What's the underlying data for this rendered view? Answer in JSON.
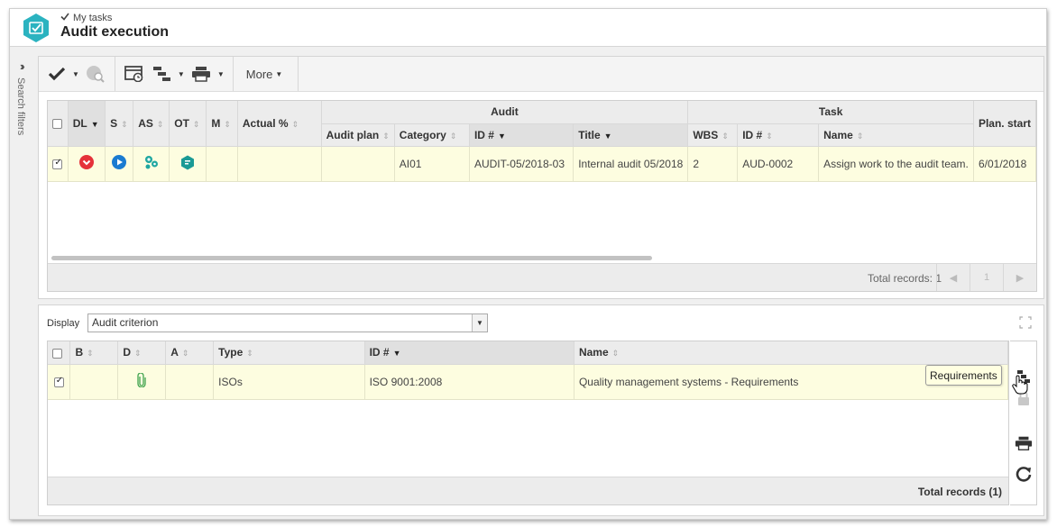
{
  "header": {
    "breadcrumb": "My tasks",
    "title": "Audit execution"
  },
  "sidebar": {
    "search_filters_label": "Search filters"
  },
  "toolbar": {
    "more_label": "More"
  },
  "top_grid": {
    "group_headers": {
      "audit": "Audit",
      "task": "Task"
    },
    "columns": {
      "dl": "DL",
      "s": "S",
      "as": "AS",
      "ot": "OT",
      "m": "M",
      "actual": "Actual %",
      "audit_plan": "Audit plan",
      "category": "Category",
      "audit_id": "ID #",
      "title": "Title",
      "wbs": "WBS",
      "task_id": "ID #",
      "name": "Name",
      "plan_start": "Plan. start"
    },
    "rows": [
      {
        "dl": "",
        "s": "",
        "as": "",
        "ot": "",
        "m": "",
        "actual": "",
        "audit_plan": "",
        "category": "AI01",
        "audit_id": "AUDIT-05/2018-03",
        "title": "Internal audit 05/2018",
        "wbs": "2",
        "task_id": "AUD-0002",
        "name": "Assign work to the audit team.",
        "plan_start": "6/01/2018"
      }
    ],
    "total_records": "Total records: 1",
    "page": "1"
  },
  "bottom": {
    "display_label": "Display",
    "display_value": "Audit criterion",
    "columns": {
      "b": "B",
      "d": "D",
      "a": "A",
      "type": "Type",
      "id": "ID #",
      "name": "Name"
    },
    "rows": [
      {
        "type": "ISOs",
        "id": "ISO 9001:2008",
        "name": "Quality management systems - Requirements"
      }
    ],
    "total_records": "Total records (1)",
    "tooltip": "Requirements"
  },
  "colors": {
    "row_highlight": "#fdfde0",
    "app_logo": "#2bb3c0",
    "dl_red": "#e5323a",
    "status_blue": "#1a7bd1",
    "ot_teal": "#1a9a95"
  }
}
